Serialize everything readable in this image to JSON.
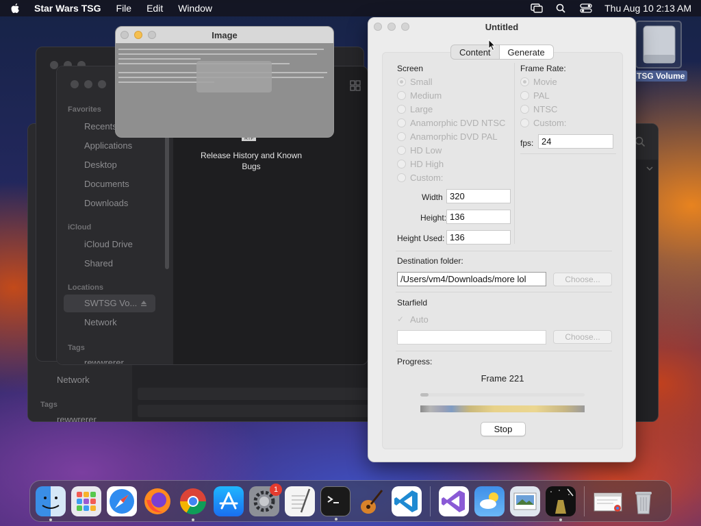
{
  "menubar": {
    "app_name": "Star Wars TSG",
    "menus": [
      "File",
      "Edit",
      "Window"
    ],
    "datetime": "Thu Aug 10  2:13 AM"
  },
  "finder": {
    "favorites_heading": "Favorites",
    "favorites": [
      "Recents",
      "Applications",
      "Desktop",
      "Documents",
      "Downloads"
    ],
    "icloud_heading": "iCloud",
    "icloud": [
      "iCloud Drive",
      "Shared"
    ],
    "locations_heading": "Locations",
    "locations": [
      "SWTSG Vo...",
      "Network"
    ],
    "tags_heading": "Tags",
    "tags": [
      "rewwrerer"
    ],
    "file_name": "Release History and Known Bugs",
    "file_badge": "RTF",
    "back_network": "Network",
    "back_tags_heading": "Tags",
    "back_tag": "rewwrerer"
  },
  "image_window": {
    "title": "Image"
  },
  "dialog": {
    "title": "Untitled",
    "tabs": [
      "Content",
      "Generate"
    ],
    "active_tab": "Generate",
    "screen": {
      "label": "Screen",
      "options": [
        "Small",
        "Medium",
        "Large",
        "Anamorphic DVD NTSC",
        "Anamorphic DVD PAL",
        "HD Low",
        "HD High",
        "Custom:"
      ],
      "selected": "Small",
      "width_label": "Width",
      "width_value": "320",
      "height_label": "Height:",
      "height_value": "136",
      "height_used_label": "Height Used:",
      "height_used_value": "136"
    },
    "frame_rate": {
      "label": "Frame Rate:",
      "options": [
        "Movie",
        "PAL",
        "NTSC",
        "Custom:"
      ],
      "selected": "Movie",
      "fps_label": "fps:",
      "fps_value": "24"
    },
    "destination": {
      "label": "Destination folder:",
      "value": "/Users/vm4/Downloads/more lol",
      "choose_label": "Choose..."
    },
    "starfield": {
      "label": "Starfield",
      "auto_label": "Auto",
      "auto_checked": true,
      "value": "",
      "choose_label": "Choose..."
    },
    "progress": {
      "label": "Progress:",
      "status": "Frame 221",
      "fraction": 0.05,
      "stop_label": "Stop"
    }
  },
  "desktop_icon": {
    "label": "TSG Volume"
  },
  "dock": {
    "apps": [
      "finder-icon",
      "launchpad-icon",
      "safari-icon",
      "firefox-icon",
      "chrome-icon",
      "app-store-icon",
      "system-settings-icon",
      "textedit-icon",
      "terminal-icon",
      "garageband-icon",
      "vscode-icon",
      "visual-studio-icon",
      "weather-icon",
      "preview-icon",
      "star-wars-tsg-icon",
      "downloads-stack-icon",
      "trash-icon"
    ],
    "settings_badge": "1"
  }
}
